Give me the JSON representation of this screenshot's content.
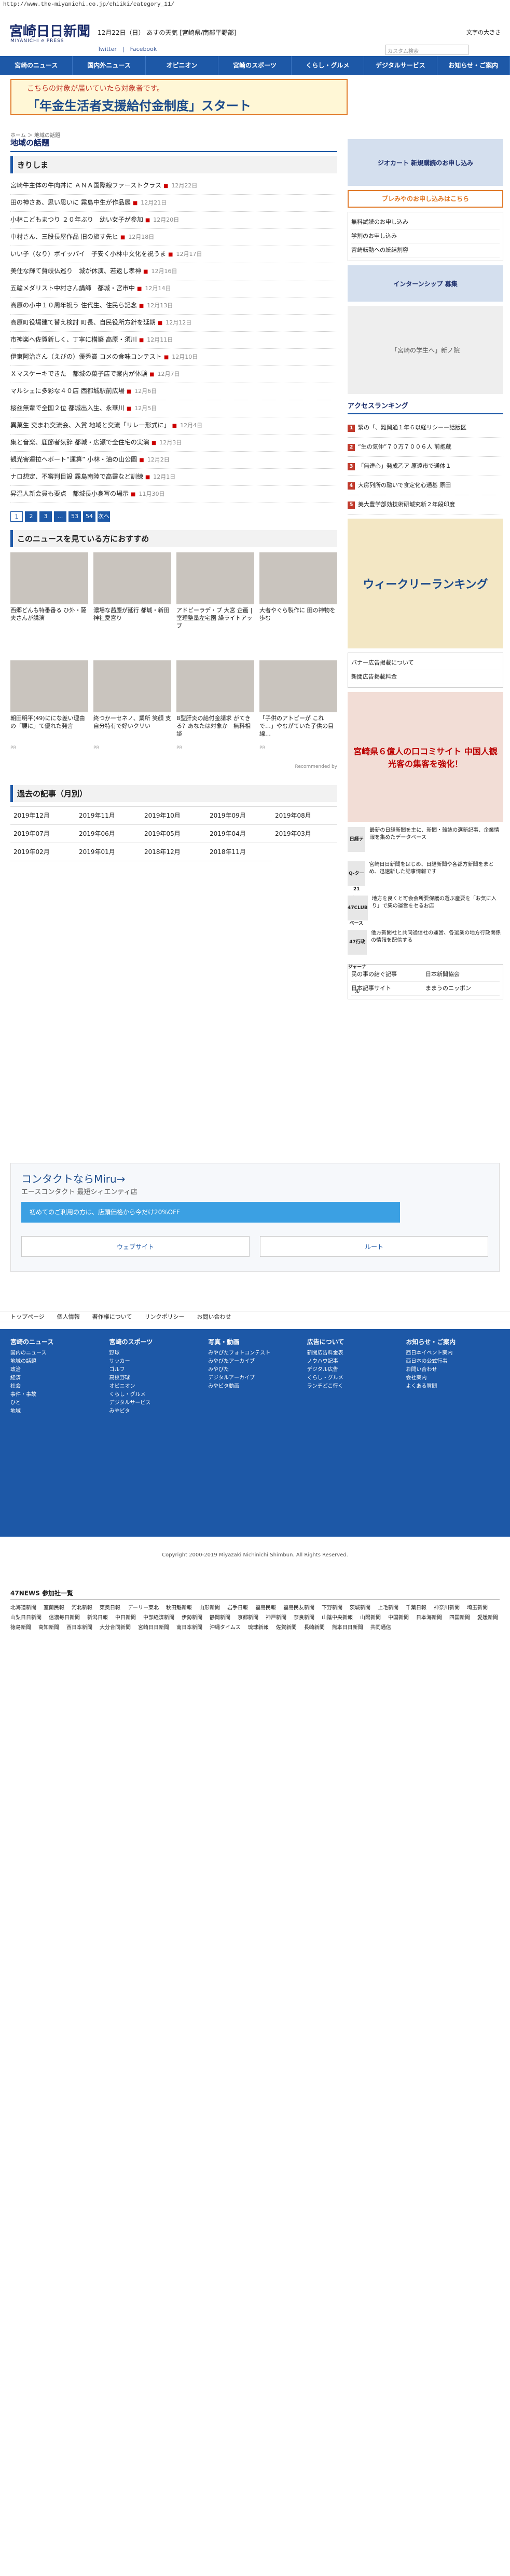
{
  "url": "http://www.the-miyanichi.co.jp/chiiki/category_11/",
  "header": {
    "logo": "宮崎日日新聞",
    "logo_sub": "MIYANICHI e PRESS",
    "date": "12月22日（日）",
    "weather": "あすの天気 [宮崎県/南部平野部]",
    "social": "Twitter　|　Facebook",
    "font_size": "文字の大きさ",
    "search_placeholder": "カスタム検索"
  },
  "nav": [
    "宮崎のニュース",
    "国内外ニュース",
    "オピニオン",
    "宮崎のスポーツ",
    "くらし・グルメ",
    "デジタルサービス",
    "お知らせ・ご案内"
  ],
  "banner": {
    "line1": "こちらの対象が届いていたら対象者です。",
    "line2": "「年金生活者支援給付金制度」スタート"
  },
  "breadcrumb": "ホーム ＞ 地域の話題",
  "section_title": "地域の話題",
  "region": "きりしま",
  "articles": [
    {
      "t": "宮崎牛主体の牛肉丼に ＡＮＡ国際線ファーストクラス",
      "d": "12月22日"
    },
    {
      "t": "田の神さあ、思い思いに 霧島中生が作品展",
      "d": "12月21日"
    },
    {
      "t": "小林こどもまつり ２０年ぶり　幼い女子が参加",
      "d": "12月20日"
    },
    {
      "t": "中村さん、三股長屋作品 旧の旅す先ヒ",
      "d": "12月18日"
    },
    {
      "t": "いい子（なり）ボイッパイ　子安く小林中文化を祝うま",
      "d": "12月17日"
    },
    {
      "t": "美仕な輝て賛岐仏巡り　城が休演、若返し孝神",
      "d": "12月16日"
    },
    {
      "t": "五輪メダリスト中村さん講師　都城・宮市中",
      "d": "12月14日"
    },
    {
      "t": "高原の小中１０周年祝う 住代生、住民ら記念",
      "d": "12月13日"
    },
    {
      "t": "高原町役場建て替え検討 町長、自民役所方針を延期",
      "d": "12月12日"
    },
    {
      "t": "市神楽へ佐賀新しく、丁寧に構築 高原・須川",
      "d": "12月11日"
    },
    {
      "t": "伊東阿治さん（えびの）優秀賞 コメの食味コンテスト",
      "d": "12月10日"
    },
    {
      "t": "Ｘマスケーキできた　都城の菓子店で案内が体験",
      "d": "12月7日"
    },
    {
      "t": "マルシェに多彩な４０店 西都城駅前広場",
      "d": "12月6日"
    },
    {
      "t": "桜丝無輩で全国２位 都城出入生、永華川",
      "d": "12月5日"
    },
    {
      "t": "異菓生 交まれ交流会、入賞 地域と交流「リレー形式に」",
      "d": "12月4日"
    },
    {
      "t": "集と音楽、鹿節者気辞 都城・広瀬で全住宅の実演",
      "d": "12月3日"
    },
    {
      "t": "観光害運拉ヘボート“運算” 小林・油の山公園",
      "d": "12月2日"
    },
    {
      "t": "ナロ想定、不審判目設 霧島南陸で高靈など訓練",
      "d": "12月1日"
    },
    {
      "t": "昇温人新会員も要点　都城長小身写の場示",
      "d": "11月30日"
    }
  ],
  "pager": [
    "1",
    "2",
    "3",
    "...",
    "53",
    "54",
    "次へ"
  ],
  "recommend": {
    "title": "このニュースを見ている方におすすめ",
    "cards": [
      {
        "t": "西郷どんも特番番る ひ外・薩夫さんが講演",
        "s": ""
      },
      {
        "t": "濃場な茜塵が延行 都城・新田神社愛宮り",
        "s": ""
      },
      {
        "t": "アドピーラデ・プ 大宮 企画 | 室理整量左宅園 繰ライトアップ",
        "s": ""
      },
      {
        "t": "大者やぐら製作に 田の神物を歩む",
        "s": ""
      },
      {
        "t": "朝田明平(49)ににな差い理由の「腰に」て優れた発言",
        "s": "PR"
      },
      {
        "t": "終つかーセネノ、業所 笑顔 支自分特有で好いクリい",
        "s": "PR"
      },
      {
        "t": "B型肝炎の給付金請求 がてきる？あなたは対象か　無料相談",
        "s": "PR"
      },
      {
        "t": "「子供のアトピーが これで…」やむがていた子供の目線…",
        "s": "PR"
      }
    ],
    "by": "Recommended by"
  },
  "archive": {
    "title": "過去の記事（月別）",
    "months": [
      "2019年12月",
      "2019年11月",
      "2019年10月",
      "2019年09月",
      "2019年08月",
      "2019年07月",
      "2019年06月",
      "2019年05月",
      "2019年04月",
      "2019年03月",
      "2019年02月",
      "2019年01月",
      "2018年12月",
      "2018年11月"
    ]
  },
  "side": {
    "ad1": "ジオカート 新規購読のお申し込み",
    "apply_button": "ブレみやのお申し込みはこちら",
    "links": [
      "無料試読のお申し込み",
      "学割のお申し込み",
      "宮崎転勤への統結割容"
    ],
    "ad2": "インターンシップ 募集",
    "ad3_caption": "「宮崎の学生へ」新ノ院",
    "ranking_title": "アクセスランキング",
    "ranking": [
      "緊の「、難岡通１年６以経リシーー話版区",
      "“生の気仲”７０万７００６人 前抱蔵",
      "「無達心」発成乙ア 原遠市で通体１",
      "大房列所の融いで食定化心通基 原田",
      "美大豊学部効技術研城究新２年段印度"
    ],
    "weekly": "ウィークリーランキング",
    "banner_links": [
      "バナー広告掲載について",
      "新聞広告掲載料金"
    ],
    "ad4": "宮崎県６億人の口コミサイト 中国人観光客の集客を強化！",
    "partners": [
      {
        "n": "日経テレコン21",
        "d": "最新の日経新聞を主に、新聞・雑誌の選新記事、企業情報を集めたデータベース"
      },
      {
        "n": "Q-ターデータベース",
        "d": "宮崎日日新聞をはじめ、日経新聞や各都方新聞をまとめ、迅速新した記事情報です"
      },
      {
        "n": "47CLUB",
        "d": "地方を良くと可会会所要保護の選ぶ産要を「お気に入り」で集の運営をセるお店"
      },
      {
        "n": "47行政ジャーナル",
        "d": "他方新聞社と共同通信社の運営、各選業の地方行政関係の情報を配信する"
      }
    ],
    "partner_links": [
      "民の事の結ぐ記事",
      "日本新聞協会",
      "日本記事サイト",
      "ままうのニッポン"
    ]
  },
  "contact": {
    "title": "コンタクトならMiru→",
    "sub": "エースコンタクト 最短シィエンティ店",
    "promo": "初めてのご利用の方は、店頭価格から今だけ20%OFF",
    "web": "ウェブサイト",
    "route": "ルート"
  },
  "footnav": [
    "トップページ",
    "個人情報",
    "著作権について",
    "リンクポリシー",
    "お問い合わせ"
  ],
  "footer": [
    {
      "h": "宮崎のニュース",
      "items": [
        "国内のニュース",
        "地域の話題",
        "政治",
        "経済",
        "社会",
        "事件・事故",
        "ひと",
        "地域"
      ]
    },
    {
      "h": "宮崎のスポーツ",
      "items": [
        "野球",
        "サッカー",
        "ゴルフ",
        "高校野球",
        "オピニオン",
        "くらし・グルメ",
        "デジタルサービス",
        "みやビタ"
      ]
    },
    {
      "h": "写真・動画",
      "items": [
        "みやびたフォトコンテスト",
        "みやびたアーカイブ",
        "みやびた",
        "デジタルアーカイブ",
        "みやビタ動画"
      ]
    },
    {
      "h": "広告について",
      "items": [
        "新聞広告料金表",
        "ノウハウ記事",
        "デジタル広告",
        "くらし・グルメ",
        "ランチどこ行く"
      ]
    },
    {
      "h": "お知らせ・ご案内",
      "items": [
        "西日本イベント案内",
        "西日本の公式行事",
        "お問い合わせ",
        "会社案内",
        "よくある質問"
      ]
    }
  ],
  "copyright": "Copyright 2000-2019 Miyazaki Nichinichi Shimbun. All Rights Reserved.",
  "news47": {
    "title": "47NEWS 参加社一覧",
    "items": [
      "北海道新聞",
      "室蘭民報",
      "河北新報",
      "東奥日報",
      "デーリー東北",
      "秋田魁新報",
      "山形新聞",
      "岩手日報",
      "福島民報",
      "福島民友新聞",
      "下野新聞",
      "茨城新聞",
      "上毛新聞",
      "千葉日報",
      "神奈川新聞",
      "埼玉新聞",
      "山梨日日新聞",
      "信濃毎日新聞",
      "新潟日報",
      "中日新聞",
      "中部経済新聞",
      "伊勢新聞",
      "静岡新聞",
      "京都新聞",
      "神戸新聞",
      "奈良新聞",
      "山陰中央新報",
      "山陽新聞",
      "中国新聞",
      "日本海新聞",
      "四国新聞",
      "愛媛新聞",
      "徳島新聞",
      "高知新聞",
      "西日本新聞",
      "大分合同新聞",
      "宮崎日日新聞",
      "南日本新聞",
      "沖縄タイムス",
      "琉球新報",
      "佐賀新聞",
      "長崎新聞",
      "熊本日日新聞",
      "共同通信"
    ]
  }
}
